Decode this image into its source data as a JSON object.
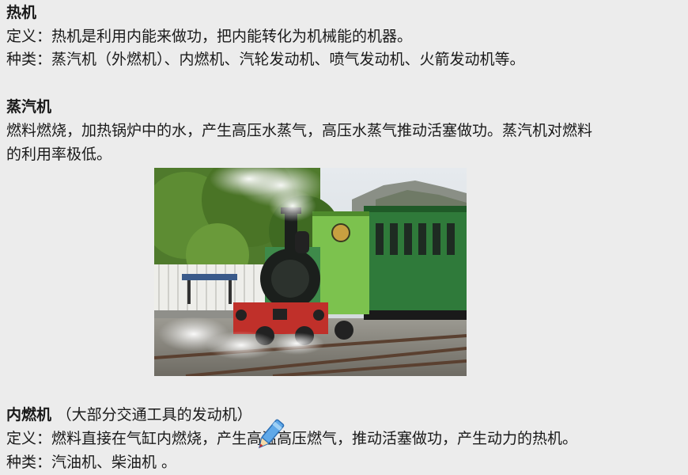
{
  "heat_engine": {
    "title": "热机",
    "definition": "定义：热机是利用内能来做功，把内能转化为机械能的机器。",
    "types": "种类：蒸汽机（外燃机）、内燃机、汽轮发动机、喷气发动机、火箭发动机等。"
  },
  "steam_engine": {
    "title": "蒸汽机",
    "line1": "燃料燃烧，加热锅炉中的水，产生高压水蒸气，高压水蒸气推动活塞做功。蒸汽机对燃料",
    "line2": "的利用率极低。"
  },
  "internal_combustion": {
    "title": "内燃机",
    "note": "（大部分交通工具的发动机）",
    "definition": "定义：燃料直接在气缸内燃烧，产生高温高压燃气，推动活塞做功，产生动力的热机。",
    "types": "种类：汽油机、柴油机 。"
  },
  "icons": {
    "pen": "pen-cursor-icon"
  },
  "colors": {
    "text": "#1a1a1a",
    "background": "#ececec",
    "locomotive_green": "#3e8a4a",
    "buffer_red": "#c0302a"
  }
}
